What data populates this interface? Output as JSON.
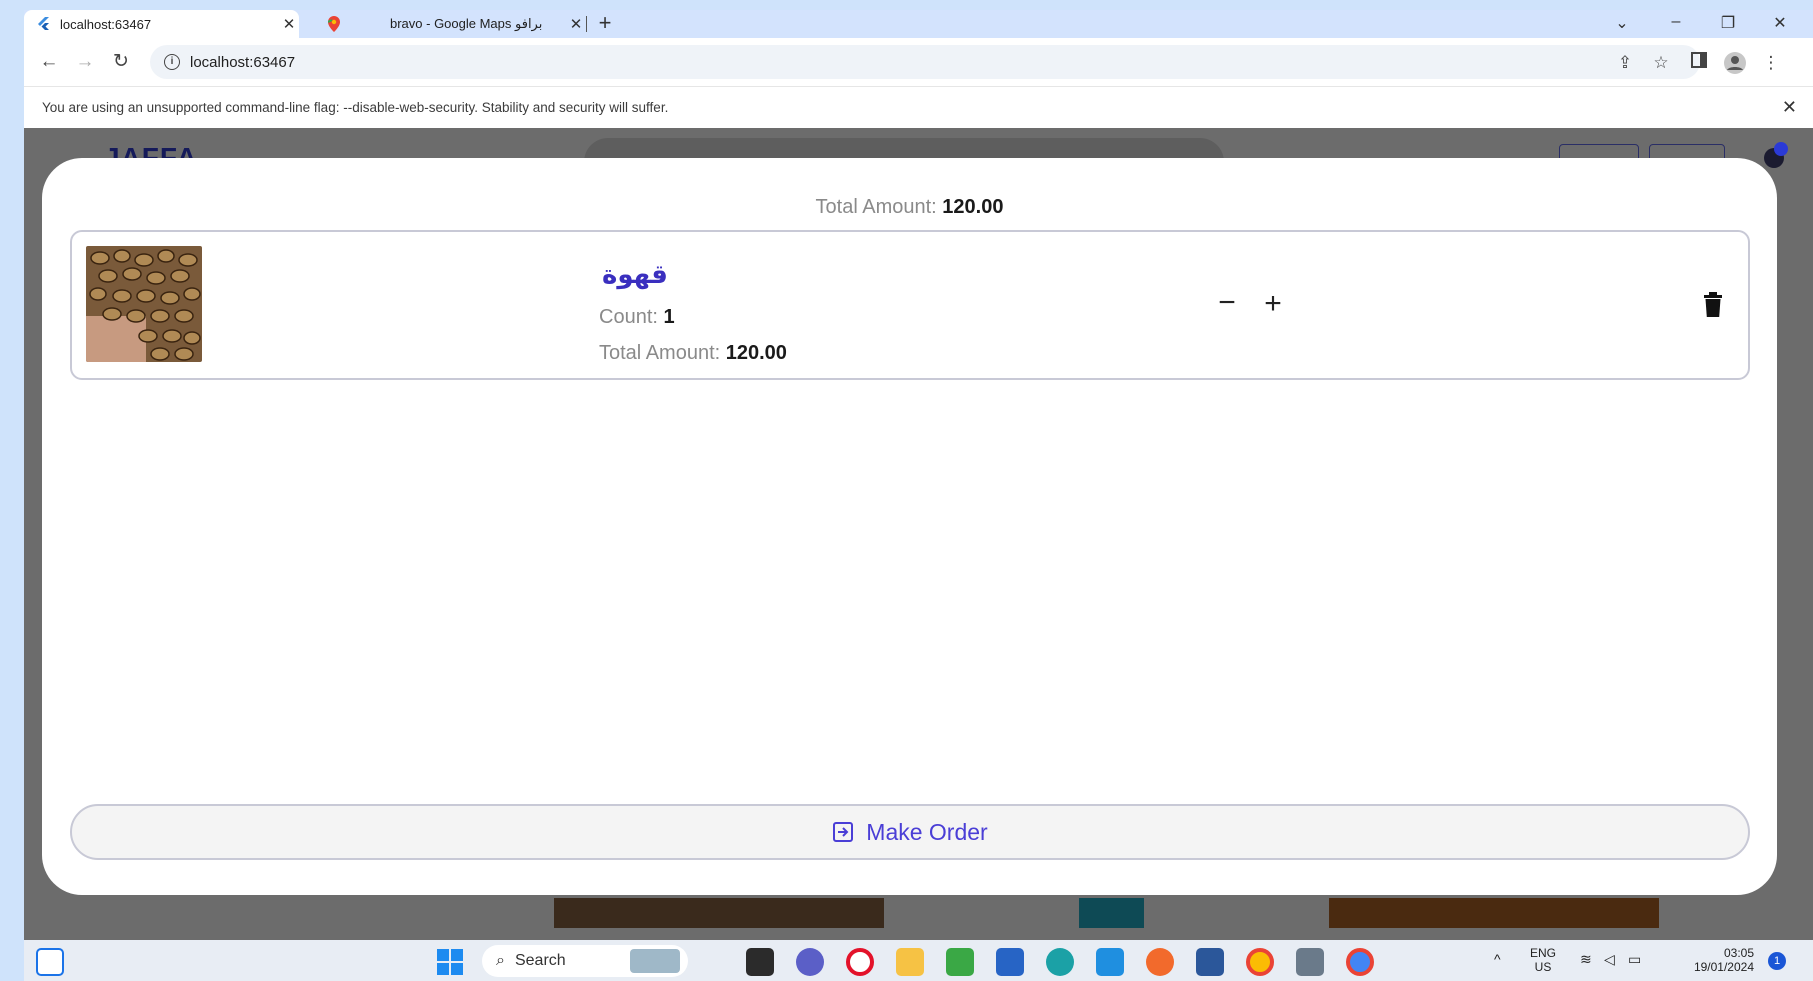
{
  "browser": {
    "tabs": [
      {
        "title": "localhost:63467",
        "active": true
      },
      {
        "title": "bravo - Google Maps برافو",
        "active": false
      }
    ],
    "address": "localhost:63467",
    "infobar": "You are using an unsupported command-line flag: --disable-web-security. Stability and security will suffer."
  },
  "background_app": {
    "logo": "JAFFA"
  },
  "sheet": {
    "total_label": "Total Amount:",
    "total_value": "120.00",
    "items": [
      {
        "name": "قهوة",
        "count_label": "Count:",
        "count_value": "1",
        "total_label": "Total Amount:",
        "total_value": "120.00"
      }
    ],
    "make_order_label": "Make Order"
  },
  "taskbar": {
    "search_label": "Search",
    "lang_top": "ENG",
    "lang_bottom": "US",
    "time": "03:05",
    "date": "19/01/2024",
    "notification_count": "1"
  },
  "colors": {
    "accent": "#4a3ed6",
    "item_name": "#3a2fbf",
    "tab_strip": "#d3e3fd"
  }
}
